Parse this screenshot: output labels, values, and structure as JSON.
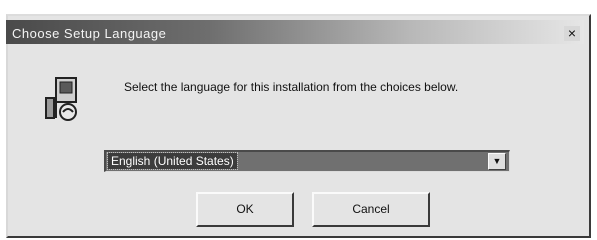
{
  "window": {
    "title": "Choose Setup Language",
    "close_glyph": "×"
  },
  "content": {
    "icon": "setup-computer-icon",
    "prompt": "Select the language for this installation from the choices below."
  },
  "language_select": {
    "selected": "English (United States)",
    "arrow_glyph": "▼"
  },
  "buttons": {
    "ok_label": "OK",
    "cancel_label": "Cancel"
  }
}
